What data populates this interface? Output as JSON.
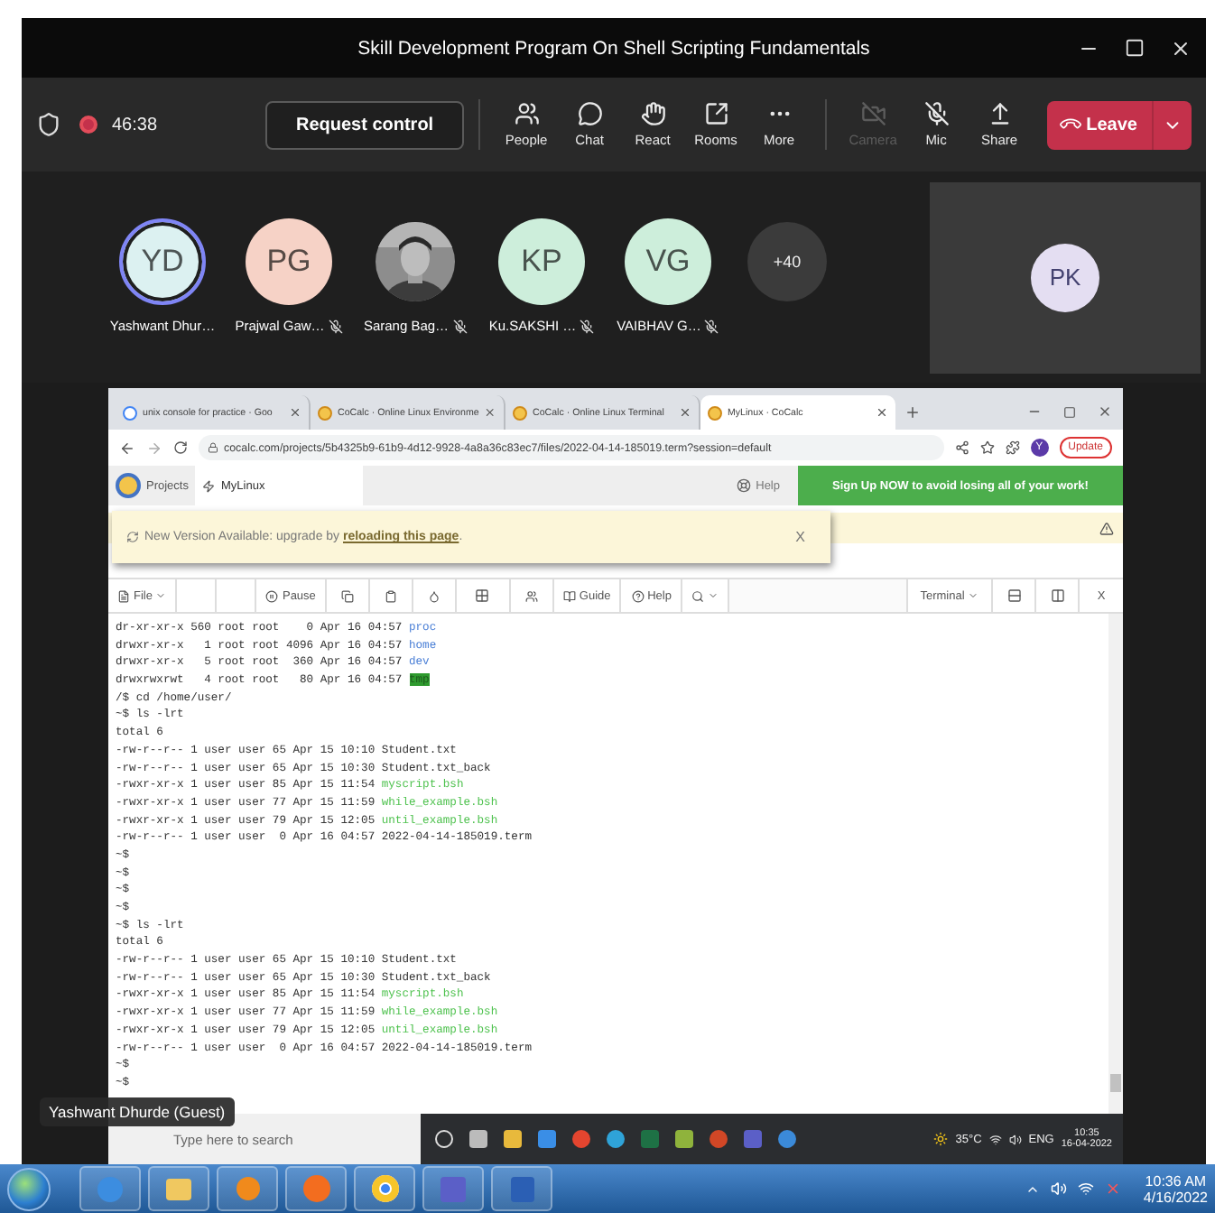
{
  "window": {
    "title": "Skill Development Program On Shell Scripting Fundamentals"
  },
  "meeting_bar": {
    "recording": true,
    "timer": "46:38",
    "request_control": "Request control",
    "buttons": [
      {
        "label": "People",
        "disabled": false
      },
      {
        "label": "Chat",
        "disabled": false
      },
      {
        "label": "React",
        "disabled": false
      },
      {
        "label": "Rooms",
        "disabled": false
      },
      {
        "label": "More",
        "disabled": false
      }
    ],
    "devices": [
      {
        "label": "Camera",
        "disabled": true
      },
      {
        "label": "Mic",
        "disabled": false
      },
      {
        "label": "Share",
        "disabled": false
      }
    ],
    "leave": "Leave"
  },
  "participants": [
    {
      "kind": "initials",
      "initials": "YD",
      "name": "Yashwant Dhur…",
      "color": "#dcf1f1",
      "speaking": true,
      "muted": false
    },
    {
      "kind": "initials",
      "initials": "PG",
      "name": "Prajwal Gaw…",
      "color": "#f6d2c6",
      "speaking": false,
      "muted": true
    },
    {
      "name": "Sarang Bag…",
      "speaking": false,
      "muted": true
    },
    {
      "kind": "initials",
      "initials": "KP",
      "name": "Ku.SAKSHI …",
      "color": "#cdeedb",
      "speaking": false,
      "muted": true
    },
    {
      "kind": "initials",
      "initials": "VG",
      "name": "VAIBHAV G…",
      "color": "#cdeedb",
      "speaking": false,
      "muted": true
    }
  ],
  "overflow": "+40",
  "spotlight": {
    "initials": "PK",
    "color": "#e4def2"
  },
  "browser": {
    "tabs": [
      {
        "kind": "search",
        "title": "unix console for practice · Goo",
        "selected": false
      },
      {
        "kind": "site",
        "title": "CoCalc · Online Linux Environme",
        "selected": false
      },
      {
        "kind": "site",
        "title": "CoCalc · Online Linux Terminal",
        "selected": false
      },
      {
        "kind": "site",
        "title": "MyLinux · CoCalc",
        "selected": true
      }
    ],
    "url": "cocalc.com/projects/5b4325b9-61b9-4d12-9928-4a8a36c83ec7/files/2022-04-14-185019.term?session=default",
    "profile": "Y",
    "update": "Update"
  },
  "cocalc": {
    "projects": "Projects",
    "project": "MyLinux",
    "help": "Help",
    "signup": "Sign Up NOW to avoid losing all of your work!"
  },
  "banner": {
    "text": "New Version Available: upgrade by ",
    "link": "reloading this page",
    "end": ".",
    "close": "X"
  },
  "editor_toolbar": {
    "file": "File",
    "pause": "Pause",
    "guide": "Guide",
    "help": "Help",
    "mode": "Terminal",
    "close": "X"
  },
  "terminal": {
    "lines": [
      {
        "kind": "dir",
        "text": "dr-xr-xr-x 560 root root    0 Apr 16 04:57 ",
        "file": "proc"
      },
      {
        "kind": "dir",
        "text": "drwxr-xr-x   1 root root 4096 Apr 16 04:57 ",
        "file": "home"
      },
      {
        "kind": "dir",
        "text": "drwxr-xr-x   5 root root  360 Apr 16 04:57 ",
        "file": "dev"
      },
      {
        "kind": "sticky",
        "text": "drwxrwxrwt   4 root root   80 Apr 16 04:57 ",
        "file": "tmp"
      },
      {
        "kind": "plain",
        "text": "/$ cd /home/user/"
      },
      {
        "kind": "plain",
        "text": "~$ ls -lrt"
      },
      {
        "kind": "plain",
        "text": "total 6"
      },
      {
        "kind": "plain",
        "text": "-rw-r--r-- 1 user user 65 Apr 15 10:10 Student.txt"
      },
      {
        "kind": "plain",
        "text": "-rw-r--r-- 1 user user 65 Apr 15 10:30 Student.txt_back"
      },
      {
        "kind": "exec",
        "text": "-rwxr-xr-x 1 user user 85 Apr 15 11:54 ",
        "file": "myscript.bsh"
      },
      {
        "kind": "exec",
        "text": "-rwxr-xr-x 1 user user 77 Apr 15 11:59 ",
        "file": "while_example.bsh"
      },
      {
        "kind": "exec",
        "text": "-rwxr-xr-x 1 user user 79 Apr 15 12:05 ",
        "file": "until_example.bsh"
      },
      {
        "kind": "plain",
        "text": "-rw-r--r-- 1 user user  0 Apr 16 04:57 2022-04-14-185019.term"
      },
      {
        "kind": "plain",
        "text": "~$"
      },
      {
        "kind": "plain",
        "text": "~$"
      },
      {
        "kind": "plain",
        "text": "~$"
      },
      {
        "kind": "plain",
        "text": "~$"
      },
      {
        "kind": "plain",
        "text": "~$ ls -lrt"
      },
      {
        "kind": "plain",
        "text": "total 6"
      },
      {
        "kind": "plain",
        "text": "-rw-r--r-- 1 user user 65 Apr 15 10:10 Student.txt"
      },
      {
        "kind": "plain",
        "text": "-rw-r--r-- 1 user user 65 Apr 15 10:30 Student.txt_back"
      },
      {
        "kind": "exec",
        "text": "-rwxr-xr-x 1 user user 85 Apr 15 11:54 ",
        "file": "myscript.bsh"
      },
      {
        "kind": "exec",
        "text": "-rwxr-xr-x 1 user user 77 Apr 15 11:59 ",
        "file": "while_example.bsh"
      },
      {
        "kind": "exec",
        "text": "-rwxr-xr-x 1 user user 79 Apr 15 12:05 ",
        "file": "until_example.bsh"
      },
      {
        "kind": "plain",
        "text": "-rw-r--r-- 1 user user  0 Apr 16 04:57 2022-04-14-185019.term"
      },
      {
        "kind": "plain",
        "text": "~$"
      },
      {
        "kind": "plain",
        "text": "~$"
      }
    ]
  },
  "presenter_label": "Yashwant Dhurde (Guest)",
  "shared_taskbar": {
    "search": "Type here to search",
    "weather": "35°C",
    "language": "ENG",
    "time": "10:35",
    "date": "16-04-2022"
  },
  "taskbar": {
    "time": "10:36 AM",
    "date": "4/16/2022"
  }
}
